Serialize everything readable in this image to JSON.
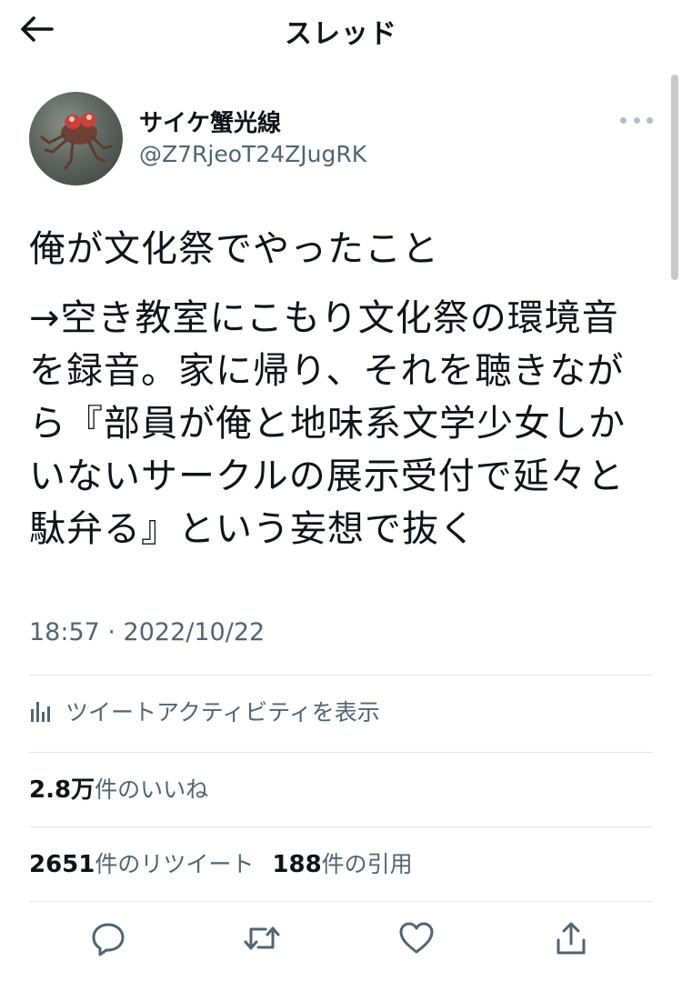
{
  "header": {
    "title": "スレッド",
    "back_icon": "arrow-left-icon"
  },
  "author": {
    "display_name": "サイケ蟹光線",
    "handle": "@Z7RjeoT24ZJugRK",
    "avatar_icon": "crab-avatar"
  },
  "tweet": {
    "lines": [
      "俺が文化祭でやったこと",
      "→空き教室にこもり文化祭の環境音",
      "を録音。家に帰り、それを聴きなが",
      "ら『部員が俺と地味系文学少女しか",
      "いないサークルの展示受付で延々と",
      "駄弁る』という妄想で抜く"
    ],
    "timestamp": "18:57 · 2022/10/22"
  },
  "activity": {
    "label": "ツイートアクティビティを表示",
    "icon": "bar-chart-icon"
  },
  "stats": {
    "likes_count": "2.8万",
    "likes_label": "件のいいね",
    "retweets_count": "2651",
    "retweets_label": "件のリツイート",
    "quotes_count": "188",
    "quotes_label": "件の引用"
  },
  "actions": [
    {
      "name": "reply",
      "icon": "comment-icon"
    },
    {
      "name": "retweet",
      "icon": "retweet-icon"
    },
    {
      "name": "like",
      "icon": "heart-icon"
    },
    {
      "name": "share",
      "icon": "share-icon"
    }
  ],
  "colors": {
    "text_primary": "#0f1419",
    "text_secondary": "#536471",
    "divider": "#e3e6e8",
    "icon_gray": "#536471"
  }
}
